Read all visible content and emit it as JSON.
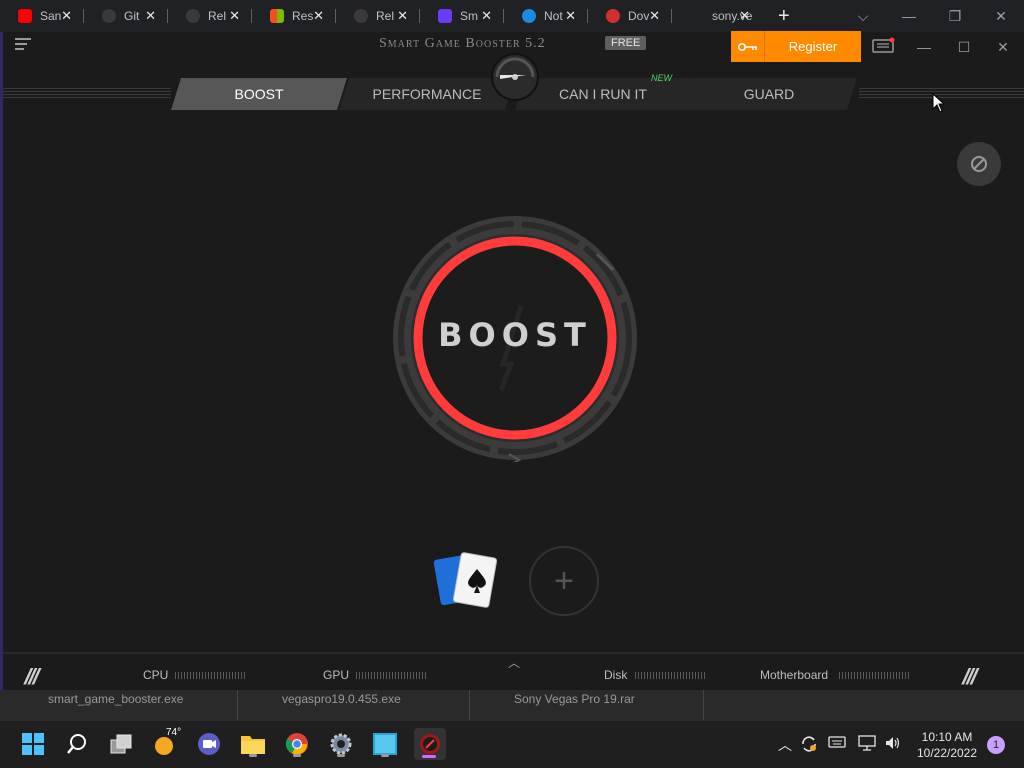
{
  "browser": {
    "tabs": [
      {
        "label": "San",
        "color": "#ff0000"
      },
      {
        "label": "Git",
        "color": "#3a3a3a"
      },
      {
        "label": "Rel",
        "color": "#3a3a3a"
      },
      {
        "label": "Res",
        "color": "#f25022"
      },
      {
        "label": "Rel",
        "color": "#3a3a3a"
      },
      {
        "label": "Sm",
        "color": "#6c3cf5"
      },
      {
        "label": "Not",
        "color": "#1e88e5"
      },
      {
        "label": "Dov",
        "color": "#d32f2f"
      },
      {
        "label": "sony.ve",
        "color": "#202124"
      }
    ],
    "new_tab": "+",
    "controls": {
      "dropdown": "⌵",
      "minimize": "—",
      "restore": "❐",
      "close": "✕"
    }
  },
  "app": {
    "title": "Smart Game Booster 5.2",
    "free_badge": "FREE",
    "register_label": "Register",
    "controls": {
      "minimize": "—",
      "maximize": "☐",
      "close": "✕"
    },
    "nav_tabs": [
      "BOOST",
      "PERFORMANCE",
      "CAN I RUN IT",
      "GUARD"
    ],
    "active_tab": "BOOST",
    "new_badge": "NEW",
    "boost_label": "BOOST",
    "add_game": "+",
    "status": {
      "cpu": "CPU",
      "gpu": "GPU",
      "disk": "Disk",
      "motherboard": "Motherboard",
      "slashes": "///"
    },
    "accent_color": "#ff3b3b",
    "register_color": "#ff8a00"
  },
  "downloads": [
    {
      "name": "smart_game_booster.exe"
    },
    {
      "name": "vegaspro19.0.455.exe"
    },
    {
      "name": "Sony Vegas Pro 19.rar"
    }
  ],
  "taskbar": {
    "weather": "74°",
    "clock_time": "10:10 AM",
    "clock_date": "10/22/2022",
    "notifications": "1",
    "icons": [
      "start-icon",
      "search-icon",
      "task-view-icon",
      "weather-icon",
      "chat-icon",
      "file-explorer-icon",
      "chrome-icon",
      "settings-icon",
      "store-icon",
      "game-booster-icon"
    ]
  }
}
